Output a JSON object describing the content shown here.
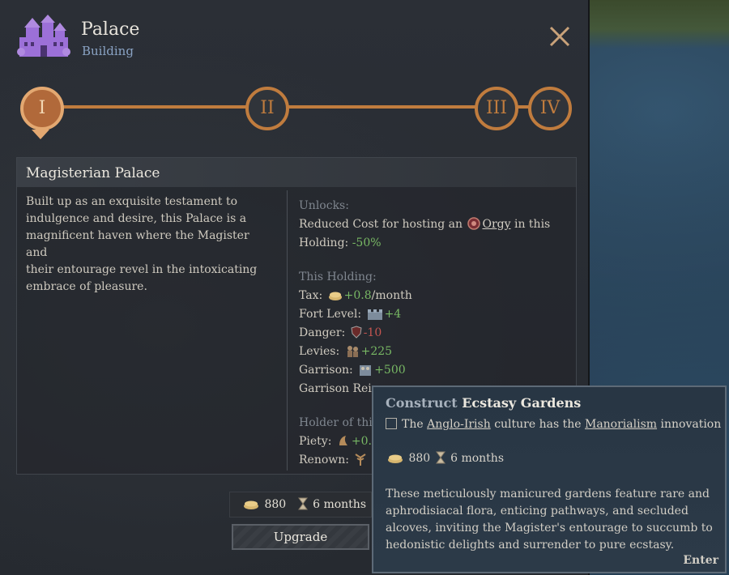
{
  "header": {
    "title": "Palace",
    "subtitle": "Building",
    "icon": "castle-icon",
    "icon_color": "#9c70d8"
  },
  "tiers": [
    {
      "label": "I",
      "active": true
    },
    {
      "label": "II",
      "active": false
    },
    {
      "label": "III",
      "active": false
    },
    {
      "label": "IV",
      "active": false
    }
  ],
  "detail": {
    "name": "Magisterian Palace",
    "description": "Built up as an exquisite testament to\nindulgence and desire, this Palace is a\nmagnificent haven where the Magister and\ntheir entourage revel in the intoxicating\nembrace of pleasure.",
    "unlocks_label": "Unlocks:",
    "unlocks_line1_pre": "Reduced Cost for hosting an",
    "unlocks_link": "Orgy",
    "unlocks_line1_post": "in this",
    "unlocks_line2_pre": "Holding:",
    "unlocks_value": "-50%",
    "holding_label": "This Holding:",
    "holding_stats": [
      {
        "label": "Tax:",
        "icon": "gold-coins-icon",
        "value": "+0.8",
        "suffix": "/month",
        "tone": "green"
      },
      {
        "label": "Fort Level:",
        "icon": "fort-icon",
        "value": "+4",
        "suffix": "",
        "tone": "green"
      },
      {
        "label": "Danger:",
        "icon": "shield-icon",
        "value": "-10",
        "suffix": "",
        "tone": "red"
      },
      {
        "label": "Levies:",
        "icon": "levies-icon",
        "value": "+225",
        "suffix": "",
        "tone": "green"
      },
      {
        "label": "Garrison:",
        "icon": "garrison-icon",
        "value": "+500",
        "suffix": "",
        "tone": "green"
      },
      {
        "label": "Garrison Rei",
        "icon": "",
        "value": "",
        "suffix": "",
        "tone": "none"
      }
    ],
    "holder_label": "Holder of thi",
    "holder_stats": [
      {
        "label": "Piety:",
        "icon": "piety-icon",
        "value": "+0.",
        "tone": "green"
      },
      {
        "label": "Renown:",
        "icon": "renown-icon",
        "value": "",
        "tone": "green"
      }
    ]
  },
  "cost": {
    "gold": "880",
    "time": "6 months"
  },
  "upgrade_label": "Upgrade",
  "tooltip": {
    "title_pre": "Construct",
    "title_name": "Ecstasy Gardens",
    "req_pre": "The",
    "req_link1": "Anglo-Irish",
    "req_mid": "culture has the",
    "req_link2": "Manorialism",
    "req_post": "innovation",
    "gold": "880",
    "time": "6 months",
    "description": "These meticulously manicured gardens feature rare and aphrodisiacal flora, enticing pathways, and secluded alcoves, inviting the Magister's entourage to succumb to hedonistic delights and surrender to pure ecstasy.",
    "enter_label": "Enter"
  }
}
